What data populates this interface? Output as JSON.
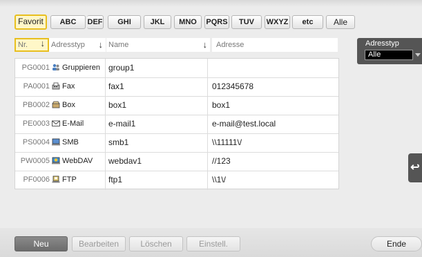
{
  "tabs": [
    "Favorit",
    "ABC",
    "DEF",
    "GHI",
    "JKL",
    "MNO",
    "PQRS",
    "TUV",
    "WXYZ",
    "etc",
    "Alle"
  ],
  "columns": {
    "nr": "Nr.",
    "type": "Adresstyp",
    "name": "Name",
    "address": "Adresse"
  },
  "rows": [
    {
      "nr": "PG0001",
      "icon": "group-icon",
      "type": "Gruppieren",
      "name": "group1",
      "address": ""
    },
    {
      "nr": "PA0001",
      "icon": "fax-icon",
      "type": "Fax",
      "name": "fax1",
      "address": "012345678"
    },
    {
      "nr": "PB0002",
      "icon": "box-icon",
      "type": "Box",
      "name": "box1",
      "address": "box1"
    },
    {
      "nr": "PE0003",
      "icon": "email-icon",
      "type": "E-Mail",
      "name": "e-mail1",
      "address": "e-mail@test.local"
    },
    {
      "nr": "PS0004",
      "icon": "smb-icon",
      "type": "SMB",
      "name": "smb1",
      "address": "\\\\11111\\/"
    },
    {
      "nr": "PW0005",
      "icon": "webdav-icon",
      "type": "WebDAV",
      "name": "webdav1",
      "address": "//123"
    },
    {
      "nr": "PF0006",
      "icon": "ftp-icon",
      "type": "FTP",
      "name": "ftp1",
      "address": "\\\\1\\/"
    }
  ],
  "filter": {
    "label": "Adresstyp",
    "value": "Alle"
  },
  "back_button": "↩",
  "footer": {
    "new": "Neu",
    "edit": "Bearbeiten",
    "delete": "Löschen",
    "settings": "Einstell.",
    "end": "Ende"
  }
}
